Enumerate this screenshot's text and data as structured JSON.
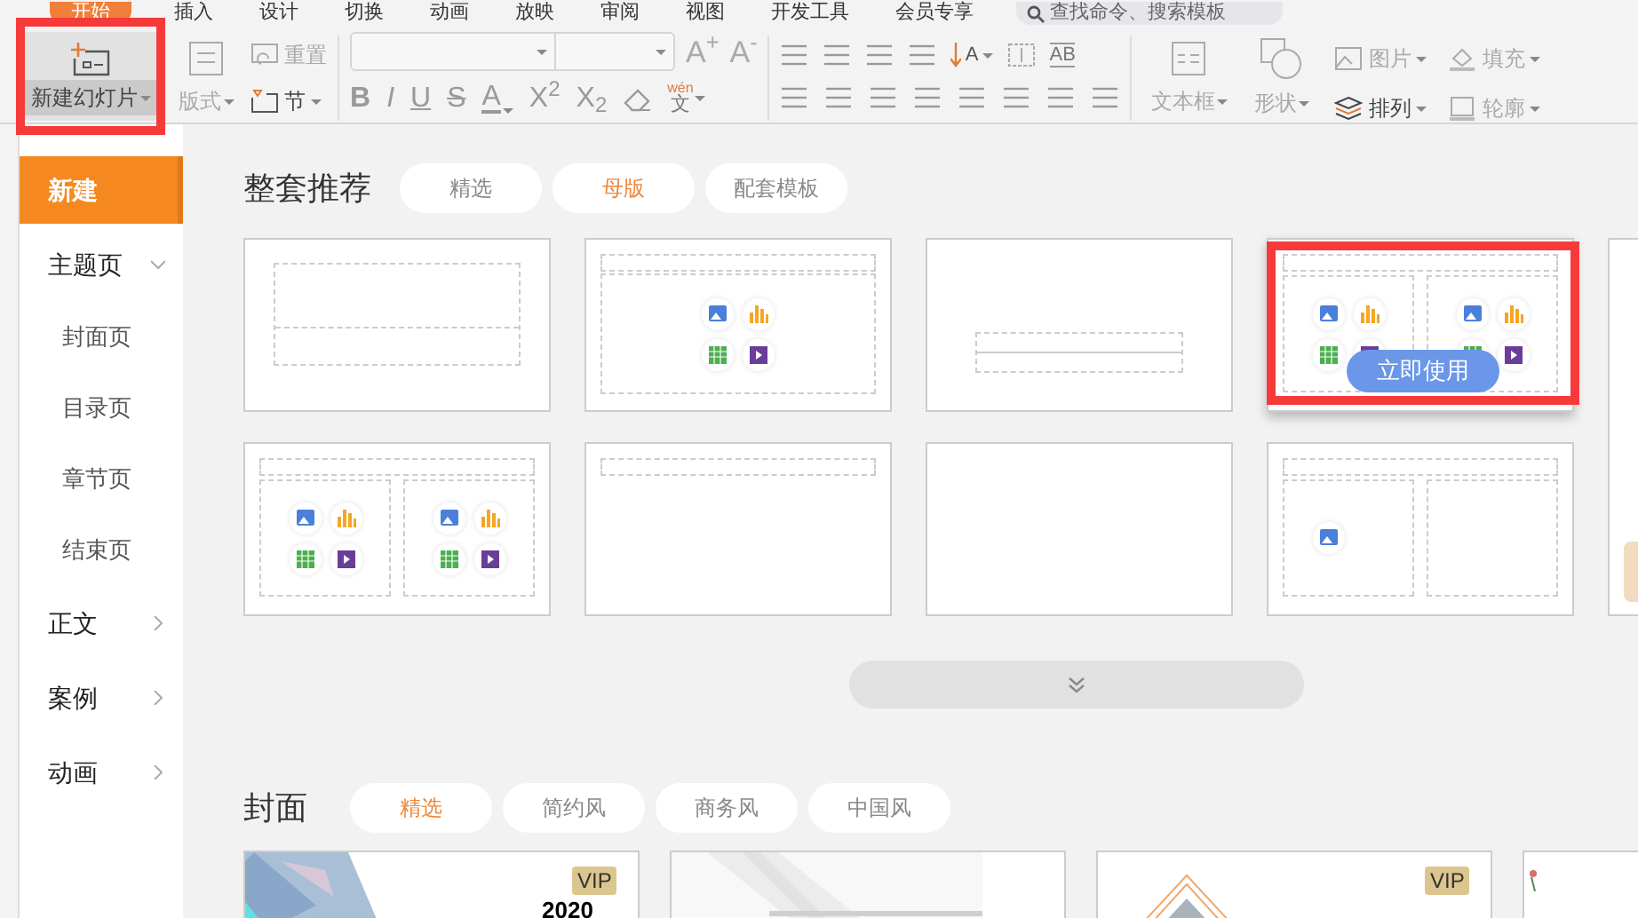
{
  "menu_tabs": [
    {
      "label": "开始",
      "selected": true
    },
    {
      "label": "插入",
      "selected": false
    },
    {
      "label": "设计",
      "selected": false
    },
    {
      "label": "切换",
      "selected": false
    },
    {
      "label": "动画",
      "selected": false
    },
    {
      "label": "放映",
      "selected": false
    },
    {
      "label": "审阅",
      "selected": false
    },
    {
      "label": "视图",
      "selected": false
    },
    {
      "label": "开发工具",
      "selected": false
    },
    {
      "label": "会员专享",
      "selected": false
    }
  ],
  "search": {
    "placeholder": "查找命令、搜索模板"
  },
  "ribbon": {
    "new_slide": {
      "label": "新建幻灯片",
      "highlighted": true
    },
    "layout": {
      "label": "版式",
      "disabled": true
    },
    "reset": {
      "label": "重置",
      "disabled": true
    },
    "section": {
      "label": "节",
      "disabled": false
    },
    "font_buttons": [
      {
        "label": "A$^{+}$"
      },
      {
        "label": "A$^{-}$"
      }
    ],
    "format_buttons": [
      {
        "kind": "bold",
        "label": "B"
      },
      {
        "kind": "italic",
        "label": "I"
      },
      {
        "kind": "underline",
        "label": "U"
      },
      {
        "kind": "strike",
        "label": "S"
      },
      {
        "kind": "color",
        "label": "A"
      },
      {
        "kind": "script",
        "label": "X$^{2}$"
      },
      {
        "kind": "script",
        "label": "X$_{2}$"
      },
      {
        "kind": "clear"
      },
      {
        "kind": "phonetic",
        "label": "wén",
        "sub": "文"
      }
    ],
    "text_direction": {
      "label": "A"
    },
    "text_case": {
      "label": "AB"
    },
    "insert_buttons": [
      {
        "kind": "textbox",
        "label": "文本框",
        "disabled": true
      },
      {
        "kind": "shape",
        "label": "形状",
        "disabled": true
      }
    ],
    "small_buttons": [
      {
        "kind": "picture",
        "label": "图片",
        "disabled": true
      },
      {
        "kind": "arrange",
        "label": "排列",
        "disabled": false
      },
      {
        "kind": "fill",
        "label": "填充",
        "disabled": true
      },
      {
        "kind": "outline",
        "label": "轮廓",
        "disabled": true
      }
    ]
  },
  "sidebar": {
    "items": [
      {
        "label": "新建",
        "selected": true
      },
      {
        "label": "主题页",
        "selected": false,
        "expanded": true,
        "children": [
          {
            "label": "封面页",
            "selected": false
          },
          {
            "label": "目录页",
            "selected": false
          },
          {
            "label": "章节页",
            "selected": false
          },
          {
            "label": "结束页",
            "selected": false
          }
        ]
      },
      {
        "label": "正文",
        "selected": false,
        "expanded": false
      },
      {
        "label": "案例",
        "selected": false,
        "expanded": false
      },
      {
        "label": "动画",
        "selected": false,
        "expanded": false
      }
    ]
  },
  "recommended": {
    "title": "整套推荐",
    "filters": [
      {
        "label": "精选",
        "selected": false
      },
      {
        "label": "母版",
        "selected": true
      },
      {
        "label": "配套模板",
        "selected": false
      }
    ],
    "templates": [
      {
        "kind": "title"
      },
      {
        "kind": "content"
      },
      {
        "kind": "section"
      },
      {
        "kind": "two",
        "highlighted": true,
        "action": "立即使用"
      },
      {
        "kind": "two"
      },
      {
        "kind": "heading"
      },
      {
        "kind": "blank"
      },
      {
        "kind": "comparison"
      }
    ]
  },
  "cover": {
    "title": "封面",
    "filters": [
      {
        "label": "精选",
        "selected": true
      },
      {
        "label": "简约风",
        "selected": false
      },
      {
        "label": "商务风",
        "selected": false
      },
      {
        "label": "中国风",
        "selected": false
      }
    ],
    "covers": [
      {
        "kind": "feather",
        "badge": "VIP",
        "heading": "2020"
      },
      {
        "kind": "light"
      },
      {
        "kind": "diamond",
        "badge": "VIP"
      },
      {
        "kind": "flower"
      }
    ]
  }
}
